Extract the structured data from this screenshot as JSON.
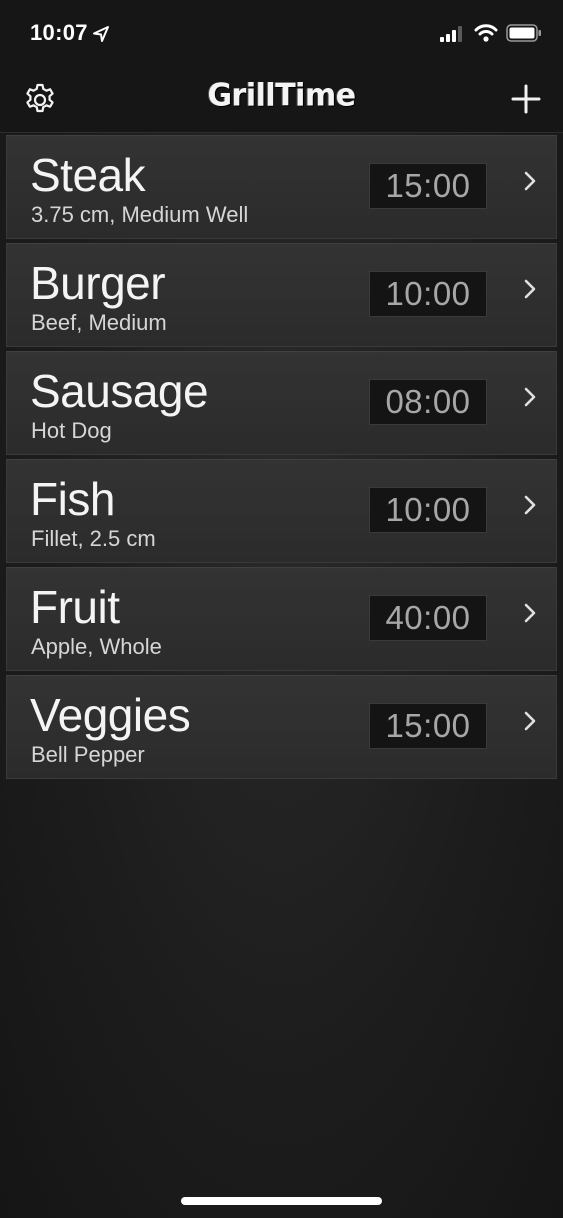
{
  "status_bar": {
    "time": "10:07"
  },
  "nav": {
    "title": "GrillTime",
    "settings_icon": "gear-icon",
    "add_icon": "plus-icon"
  },
  "items": [
    {
      "name": "Steak",
      "detail": "3.75 cm, Medium Well",
      "timer": "15:00"
    },
    {
      "name": "Burger",
      "detail": "Beef, Medium",
      "timer": "10:00"
    },
    {
      "name": "Sausage",
      "detail": "Hot Dog",
      "timer": "08:00"
    },
    {
      "name": "Fish",
      "detail": "Fillet, 2.5 cm",
      "timer": "10:00"
    },
    {
      "name": "Fruit",
      "detail": "Apple, Whole",
      "timer": "40:00"
    },
    {
      "name": "Veggies",
      "detail": "Bell Pepper",
      "timer": "15:00"
    }
  ],
  "colors": {
    "background": "#1c1c1e",
    "row": "#2f2f2f",
    "timer_bg": "#141414",
    "timer_text": "#a7a7a7",
    "text": "#f4f4f4"
  }
}
